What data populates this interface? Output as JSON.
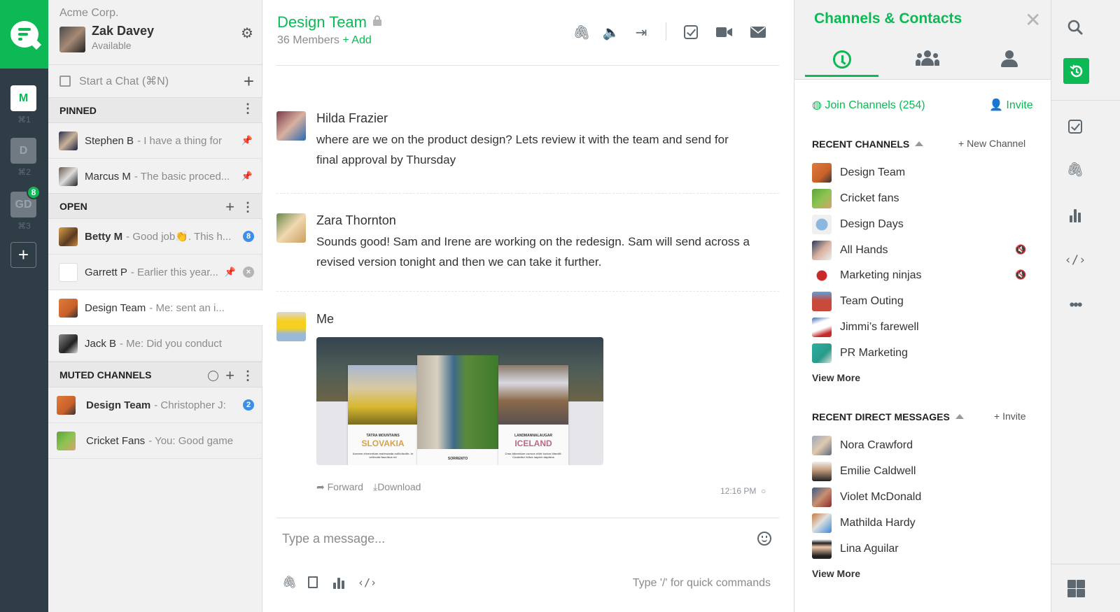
{
  "brand": {
    "accent": "#0cb954",
    "rail_bg": "#2f3d46",
    "badge_blue": "#3b8fe6"
  },
  "workspaces": [
    {
      "label": "M",
      "shortcut": "⌘1",
      "active": true
    },
    {
      "label": "D",
      "shortcut": "⌘2",
      "active": false
    },
    {
      "label": "GD",
      "shortcut": "⌘3",
      "active": false,
      "badge": "8"
    }
  ],
  "workspace_add_label": "+",
  "user": {
    "org": "Acme Corp.",
    "name": "Zak Davey",
    "status": "Available"
  },
  "sidebar": {
    "start_chat": "Start a Chat (⌘N)",
    "sections": {
      "pinned": {
        "title": "PINNED",
        "items": [
          {
            "name": "Stephen B",
            "preview": "- I have a thing for",
            "pinned": true
          },
          {
            "name": "Marcus M",
            "preview": "- The basic proced...",
            "pinned": true
          }
        ]
      },
      "open": {
        "title": "OPEN",
        "items": [
          {
            "name": "Betty M",
            "preview": "- Good job👏. This h...",
            "bold": true,
            "badge": "8"
          },
          {
            "name": "Garrett P",
            "preview": "- Earlier this year...",
            "pinned": true,
            "closable": true
          },
          {
            "name": "Design Team",
            "preview": "- Me: sent an i...",
            "active": true
          },
          {
            "name": "Jack B",
            "preview": "- Me: Did you conduct"
          }
        ]
      },
      "muted": {
        "title": "MUTED CHANNELS",
        "items": [
          {
            "name": "Design Team",
            "preview": "- Christopher J:",
            "bold": true,
            "badge": "2"
          },
          {
            "name": "Cricket Fans",
            "preview": "- You: Good game"
          }
        ]
      }
    }
  },
  "channel": {
    "title": "Design Team",
    "members": "36 Members",
    "add_label": "+ Add",
    "header_icons": [
      "attachment-icon",
      "speaker-icon",
      "leave-icon",
      "task-icon",
      "video-icon",
      "mail-icon"
    ]
  },
  "messages": [
    {
      "author": "Hilda Frazier",
      "text": "where are we on the product design? Lets review it with the team and send for final approval by Thursday"
    },
    {
      "author": "Zara Thornton",
      "text": "Sounds good! Sam and Irene are working on the redesign. Sam will send across a revised version tonight and then we can take it further."
    },
    {
      "author": "Me",
      "attachment": {
        "cards": [
          {
            "subtitle": "TATRA MOUNTAINS",
            "title": "SLOVAKIA",
            "body": "Aenean elementum malesuada sollicitudin. In vehicula faucibus mi"
          },
          {
            "subtitle": "",
            "title": "SORRENTO",
            "body": ""
          },
          {
            "subtitle": "LANDMANNALAUGAR",
            "title": "ICELAND",
            "body": "Cras bibendum cursus nibh luctus blandit. Curabitur tellus sapien dapibus"
          }
        ]
      },
      "actions": [
        "Forward",
        "Download"
      ],
      "time": "12:16 PM",
      "status_glyph": "○"
    }
  ],
  "composer": {
    "placeholder": "Type a message...",
    "hint": "Type '/' for quick commands"
  },
  "panel": {
    "title": "Channels & Contacts",
    "tabs": [
      "recent",
      "channels",
      "contacts"
    ],
    "join_label": "Join Channels (254)",
    "invite_label": "Invite",
    "recent_channels": {
      "title": "RECENT CHANNELS",
      "action": "+ New Channel",
      "items": [
        {
          "name": "Design Team",
          "muted": false
        },
        {
          "name": "Cricket fans",
          "muted": false
        },
        {
          "name": "Design Days",
          "muted": false
        },
        {
          "name": "All Hands",
          "muted": true
        },
        {
          "name": "Marketing ninjas",
          "muted": true
        },
        {
          "name": "Team Outing",
          "muted": false
        },
        {
          "name": "Jimmi’s farewell",
          "muted": false
        },
        {
          "name": "PR Marketing",
          "muted": false
        }
      ],
      "view_more": "View More"
    },
    "recent_dms": {
      "title": "RECENT DIRECT MESSAGES",
      "action": "+ Invite",
      "items": [
        {
          "name": "Nora Crawford"
        },
        {
          "name": "Emilie Caldwell"
        },
        {
          "name": "Violet McDonald"
        },
        {
          "name": "Mathilda Hardy"
        },
        {
          "name": "Lina Aguilar"
        }
      ],
      "view_more": "View More"
    }
  },
  "right_rail": [
    "search-icon",
    "history-icon",
    "task-icon",
    "attachment-icon",
    "poll-icon",
    "code-icon",
    "more-icon",
    "apps-grid-icon"
  ]
}
